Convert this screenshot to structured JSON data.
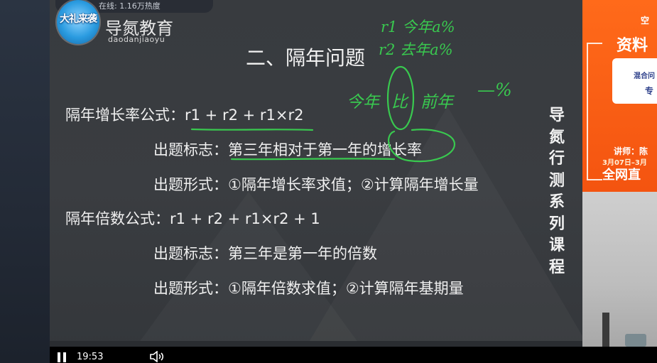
{
  "overlay": {
    "viewer_count": "在线: 1.16万热度",
    "logo_text": "大礼来袭",
    "brand_cn": "导氮教育",
    "brand_pinyin": "daodanjiaoyu"
  },
  "slide": {
    "title": "二、隔年问题",
    "line1": "隔年增长率公式：r1 + r2 + r1×r2",
    "line2": "出题标志：第三年相对于第一年的增长率",
    "line3": "出题形式：①隔年增长率求值；②计算隔年增长量",
    "line4": "隔年倍数公式：r1 + r2 + r1×r2 + 1",
    "line5": "出题标志：第三年是第一年的倍数",
    "line6": "出题形式：①隔年倍数求值；②计算隔年基期量",
    "vertical_title": "导氮行测系列课程"
  },
  "annotations": {
    "note1": "r1 今年a%",
    "note2": "r2 去年a%",
    "note3": "今年",
    "note4": "比",
    "note5": "前年",
    "note6": "—%",
    "ink_color": "#39c94f"
  },
  "promo": {
    "top": "空",
    "title": "资料",
    "card_line1": "混合问",
    "card_line2": "专",
    "teacher": "讲师：陈",
    "dates": "3月07日–3月",
    "bottom": "全网直",
    "accent_color": "#f45410"
  },
  "player": {
    "time": "19:53"
  }
}
